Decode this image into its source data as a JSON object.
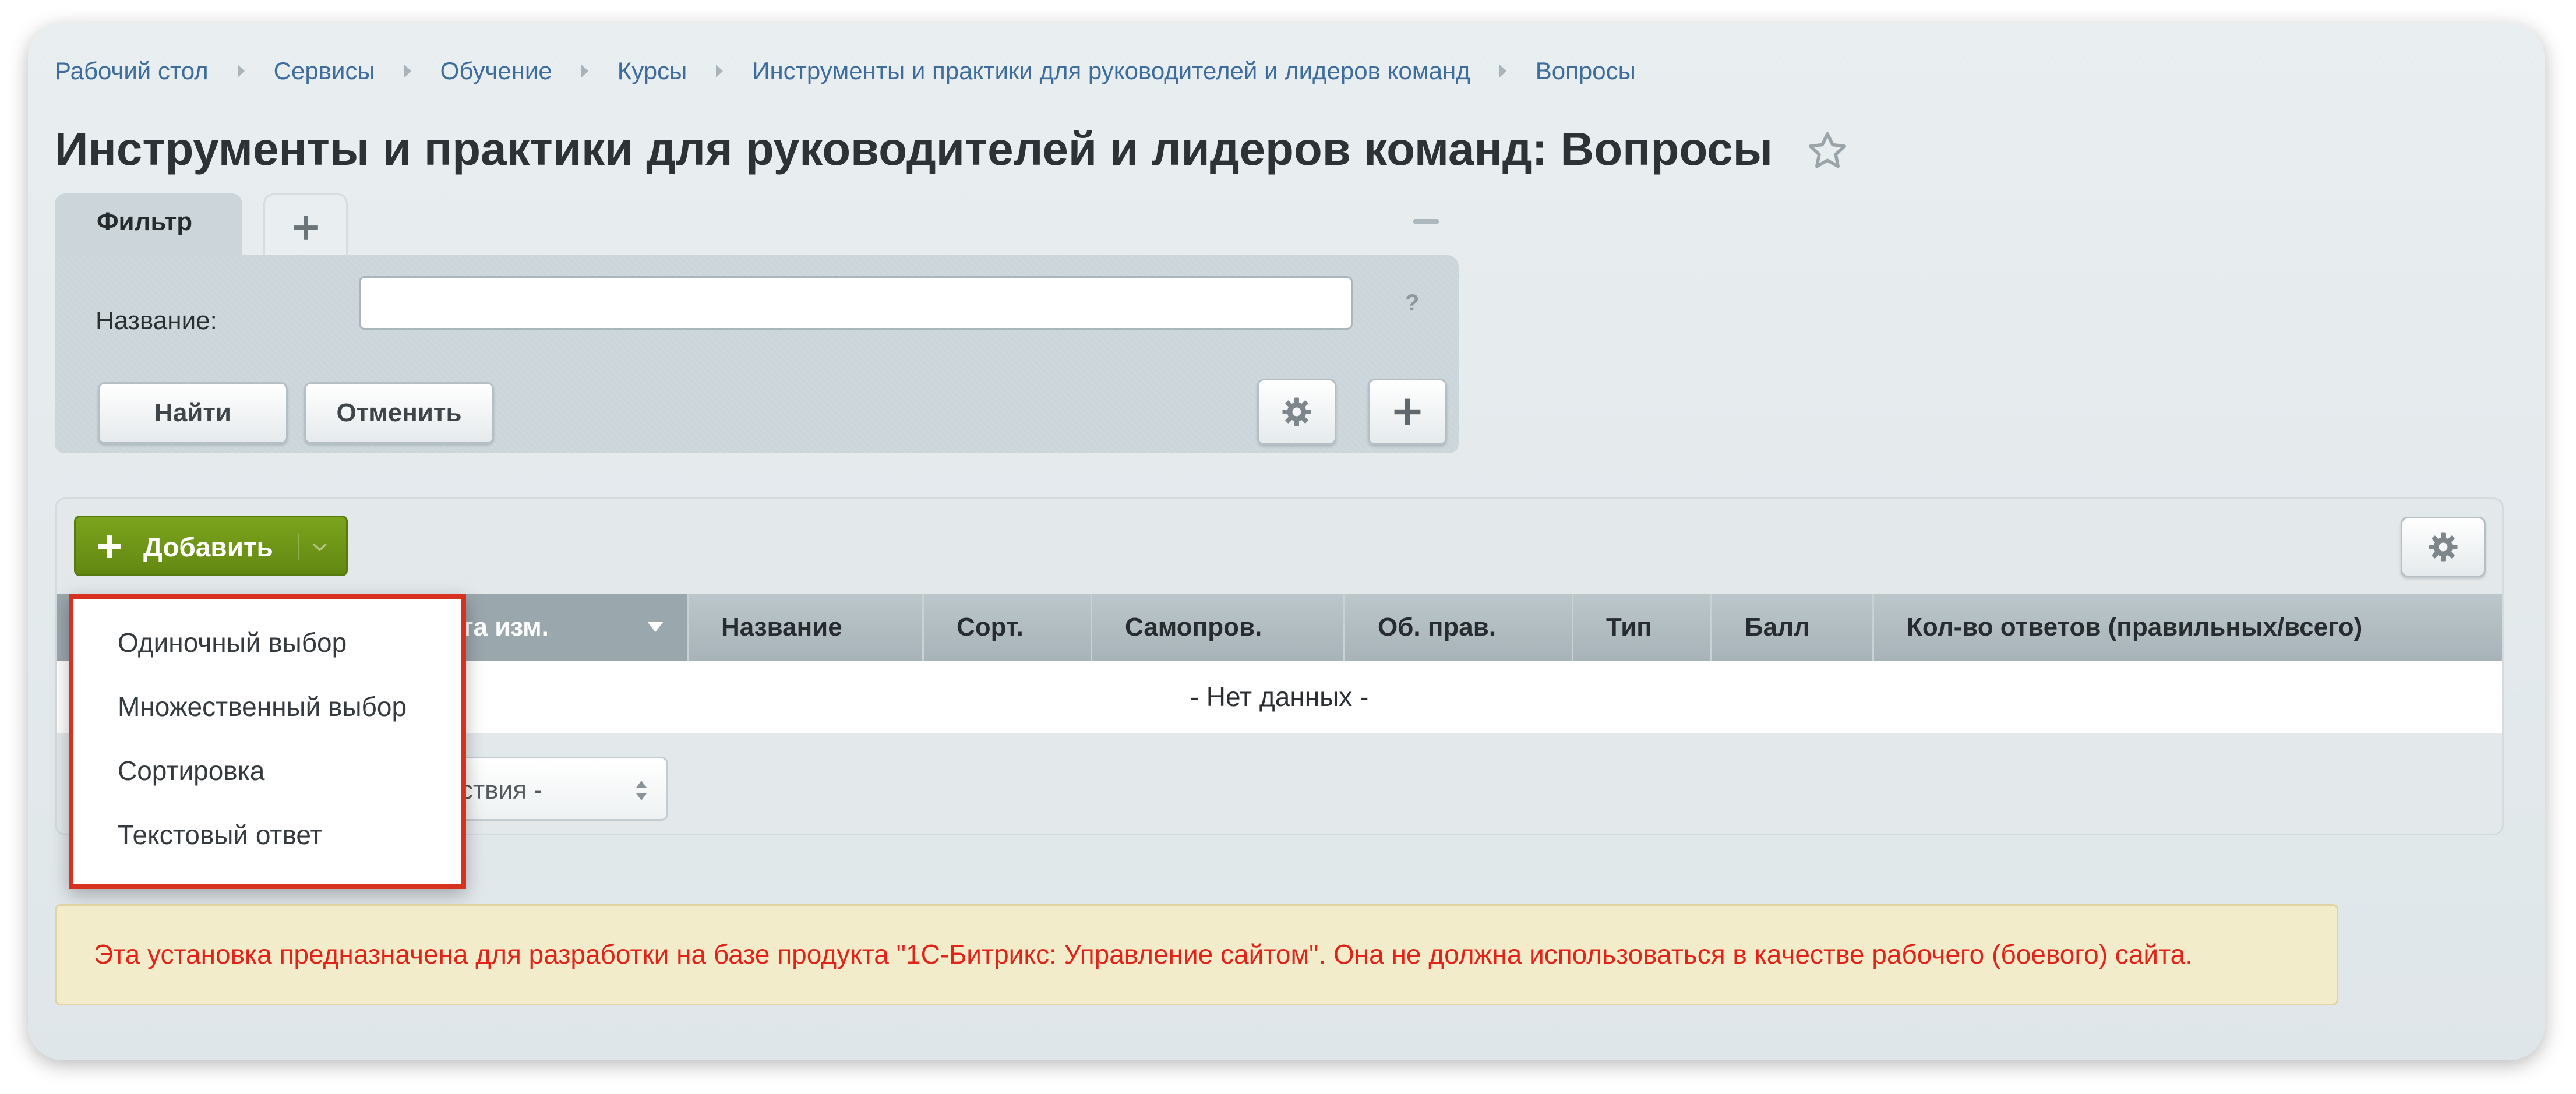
{
  "breadcrumb": [
    "Рабочий стол",
    "Сервисы",
    "Обучение",
    "Курсы",
    "Инструменты и практики для руководителей и лидеров команд",
    "Вопросы"
  ],
  "page": {
    "title": "Инструменты и практики для руководителей и лидеров команд: Вопросы"
  },
  "filter": {
    "tab_label": "Фильтр",
    "name_label": "Название:",
    "name_value": "",
    "help_mark": "?",
    "find_label": "Найти",
    "cancel_label": "Отменить"
  },
  "grid": {
    "add_label": "Добавить",
    "columns": [
      "Дата изм.",
      "Название",
      "Сорт.",
      "Самопров.",
      "Об. прав.",
      "Тип",
      "Балл",
      "Кол-во ответов (правильных/всего)"
    ],
    "sorted_column_visible": "та изм.",
    "no_data": "- Нет данных -",
    "action_select_visible": "ствия -"
  },
  "add_menu": {
    "items": [
      "Одиночный выбор",
      "Множественный выбор",
      "Сортировка",
      "Текстовый ответ"
    ]
  },
  "notice": {
    "text": "Эта установка предназначена для разработки на базе продукта \"1С-Битрикс: Управление сайтом\". Она не должна использоваться в качестве рабочего (боевого) сайта."
  },
  "colors": {
    "link": "#3e6d9c",
    "add_button": "#6f9616",
    "popup_border": "#d7321f",
    "notice_text": "#e2231a",
    "notice_bg": "#f2eccb"
  }
}
